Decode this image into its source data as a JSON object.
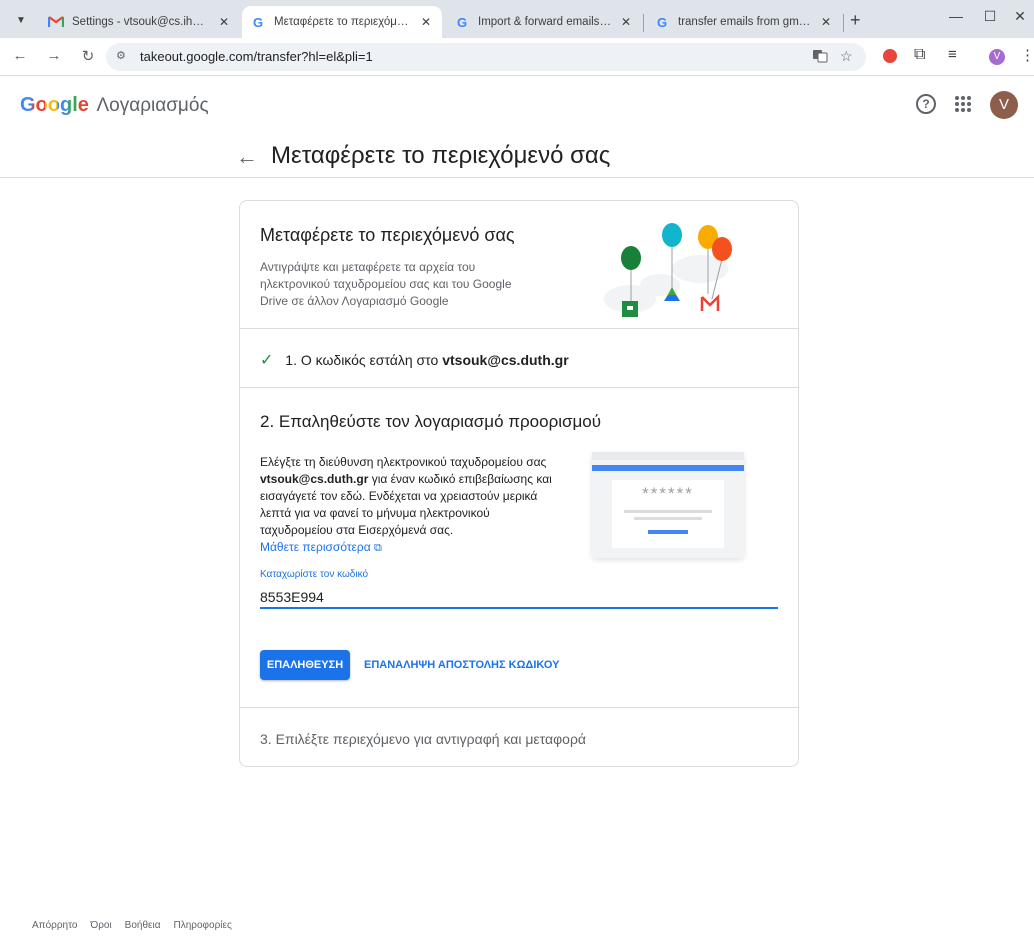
{
  "browser": {
    "tabs": [
      {
        "title": "Settings - vtsouk@cs.ihu.gr - D",
        "favicon": "gmail-icon"
      },
      {
        "title": "Μεταφέρετε το περιεχόμενό σ",
        "favicon": "google-icon"
      },
      {
        "title": "Import & forward emails - Gma",
        "favicon": "google-icon"
      },
      {
        "title": "transfer emails from gmail to a",
        "favicon": "google-icon"
      }
    ],
    "url": "takeout.google.com/transfer?hl=el&pli=1",
    "profile_initial": "V"
  },
  "header": {
    "brand": "Google",
    "product": "Λογαριασμός",
    "avatar_initial": "V"
  },
  "page": {
    "title": "Μεταφέρετε το περιεχόμενό σας"
  },
  "intro": {
    "title": "Μεταφέρετε το περιεχόμενό σας",
    "description": "Αντιγράψτε και μεταφέρετε τα αρχεία του ηλεκτρονικού ταχυδρομείου σας και του Google Drive σε άλλον Λογαριασμό Google"
  },
  "step1": {
    "text_prefix": "1. Ο κωδικός εστάλη στο",
    "email": "vtsouk@cs.duth.gr"
  },
  "step2": {
    "title": "2. Επαληθεύστε τον λογαριασμό προορισμού",
    "desc_prefix": "Ελέγξτε τη διεύθυνση ηλεκτρονικού ταχυδρομείου σας",
    "desc_email": "vtsouk@cs.duth.gr",
    "desc_suffix": "για έναν κωδικό επιβεβαίωσης και εισαγάγετέ τον εδώ. Ενδέχεται να χρειαστούν μερικά λεπτά για να φανεί το μήνυμα ηλεκτρονικού ταχυδρομείου στα Εισερχόμενά σας.",
    "learn_more": "Μάθετε περισσότερα",
    "illustration_mask": "******",
    "code_label": "Καταχωρίστε τον κωδικό",
    "code_value": "8553E994",
    "verify_button": "ΕΠΑΛΗΘΕΥΣΗ",
    "resend_button": "ΕΠΑΝΑΛΗΨΗ ΑΠΟΣΤΟΛΗΣ ΚΩΔΙΚΟΥ"
  },
  "step3": {
    "text": "3. Επιλέξτε περιεχόμενο για αντιγραφή και μεταφορά"
  },
  "footer": {
    "links": [
      "Απόρρητο",
      "Όροι",
      "Βοήθεια",
      "Πληροφορίες"
    ]
  },
  "colors": {
    "accent": "#1a73e8",
    "success": "#1e8e3e",
    "tabbar": "#dfe3ea"
  }
}
